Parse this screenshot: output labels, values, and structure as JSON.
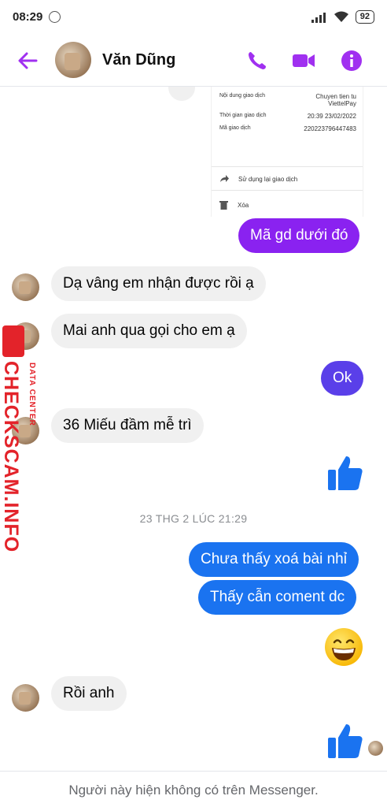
{
  "status_bar": {
    "time": "08:29",
    "battery": "92"
  },
  "header": {
    "contact_name": "Văn Dũng"
  },
  "receipt": {
    "rows": [
      {
        "label": "Nội dung giao dịch",
        "value_line1": "Chuyen tien tu",
        "value_line2": "ViettelPay"
      },
      {
        "label": "Thời gian giao dịch",
        "value_line1": "20:39 23/02/2022"
      },
      {
        "label": "Mã giao dịch",
        "value_line1": "220223796447483"
      }
    ],
    "actions": [
      {
        "label": "Sử dụng lại giao dịch"
      },
      {
        "label": "Xóa"
      }
    ]
  },
  "messages": {
    "m1": "Mã gd dưới đó",
    "m2": "Dạ vâng em nhận được rồi ạ",
    "m3": "Mai anh qua gọi cho em ạ",
    "m4": "Ok",
    "m5": "36 Miếu đầm mễ trì",
    "timestamp": "23 THG 2 LÚC 21:29",
    "m6": "Chưa thấy xoá bài nhỉ",
    "m7": "Thấy cẫn coment dc",
    "m8": "Rồi anh"
  },
  "footer": {
    "text": "Người này hiện không có trên Messenger."
  },
  "watermark": {
    "brand": "CHECKSCAM.INFO",
    "sub": "DATA CENTER"
  },
  "colors": {
    "accent": "#a030f0",
    "blue": "#1a73f0",
    "purple": "#8a22f0"
  }
}
